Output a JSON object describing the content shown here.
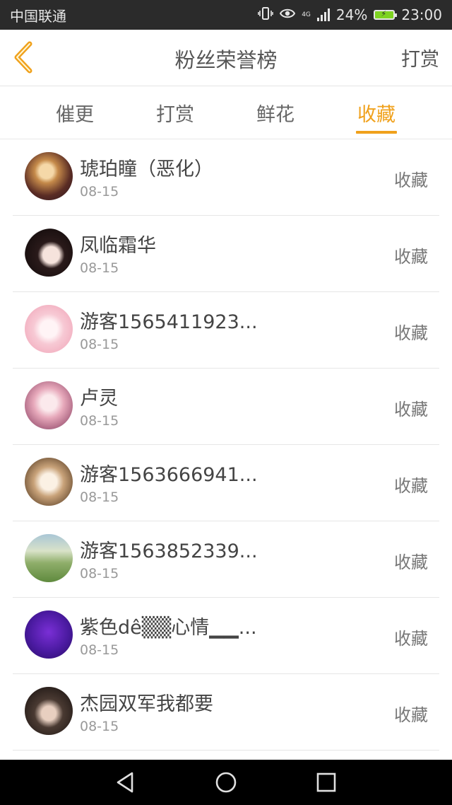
{
  "status_bar": {
    "carrier": "中国联通",
    "network": "4G",
    "battery": "24%",
    "time": "23:00"
  },
  "header": {
    "title": "粉丝荣誉榜",
    "action": "打赏"
  },
  "tabs": [
    {
      "label": "催更",
      "active": false
    },
    {
      "label": "打赏",
      "active": false
    },
    {
      "label": "鲜花",
      "active": false
    },
    {
      "label": "收藏",
      "active": true
    }
  ],
  "fans": [
    {
      "name": "琥珀瞳（恶化）",
      "date": "08-15",
      "tag": "收藏"
    },
    {
      "name": "凤临霜华",
      "date": "08-15",
      "tag": "收藏"
    },
    {
      "name": "游客1565411923...",
      "date": "08-15",
      "tag": "收藏"
    },
    {
      "name": "卢灵",
      "date": "08-15",
      "tag": "收藏"
    },
    {
      "name": "游客1563666941...",
      "date": "08-15",
      "tag": "收藏"
    },
    {
      "name": "游客1563852339...",
      "date": "08-15",
      "tag": "收藏"
    },
    {
      "name": "紫色dê▒▒心情▁▁...",
      "date": "08-15",
      "tag": "收藏"
    },
    {
      "name": "杰园双军我都要",
      "date": "08-15",
      "tag": "收藏"
    }
  ],
  "colors": {
    "accent": "#f0a11c",
    "status_bar_bg": "#2b2b2b",
    "nav_bar_bg": "#000000"
  },
  "icons": {
    "back": "chevron-left-icon",
    "nav_back": "triangle-back-icon",
    "nav_home": "circle-home-icon",
    "nav_recent": "square-recent-icon"
  }
}
